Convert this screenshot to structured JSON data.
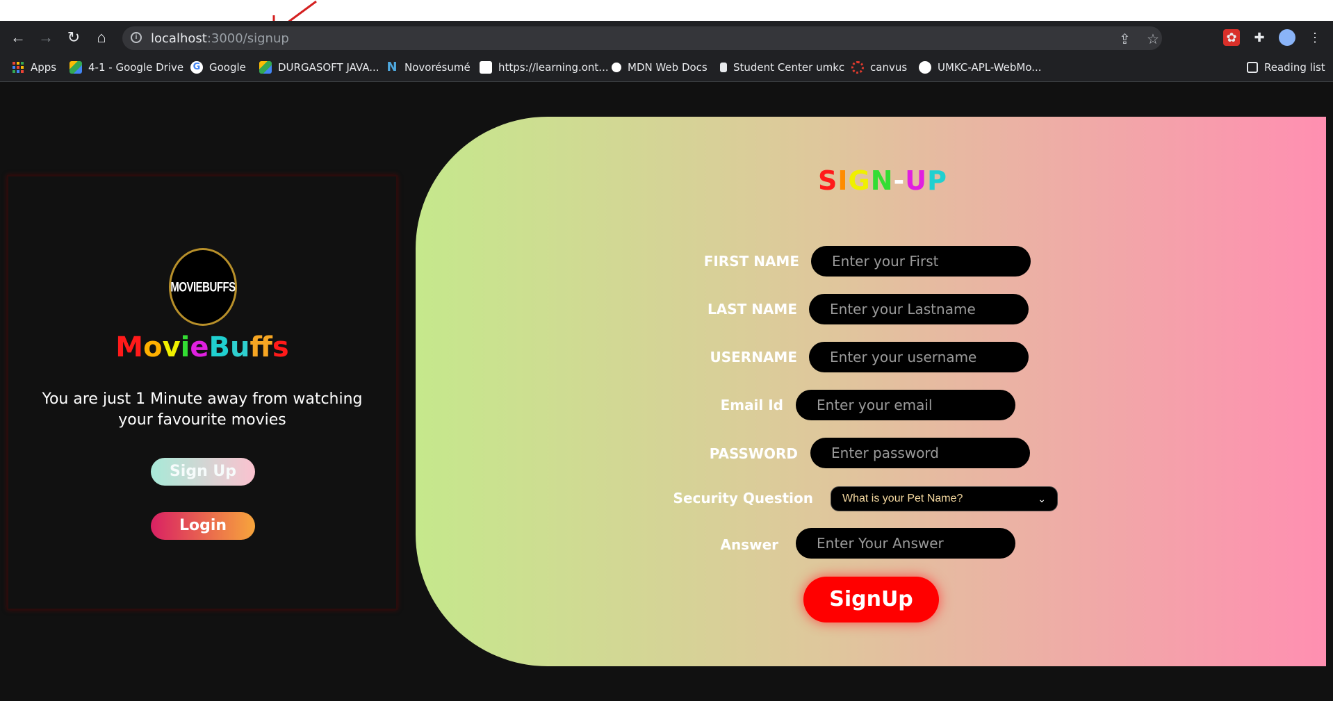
{
  "browser": {
    "url_host": "localhost",
    "url_rest": ":3000/signup",
    "bookmarks": [
      {
        "label": "Apps"
      },
      {
        "label": "4-1 - Google Drive"
      },
      {
        "label": "Google"
      },
      {
        "label": "DURGASOFT JAVA..."
      },
      {
        "label": "Novorésumé"
      },
      {
        "label": "https://learning.ont..."
      },
      {
        "label": "MDN Web Docs"
      },
      {
        "label": "Student Center umkc"
      },
      {
        "label": "canvus"
      },
      {
        "label": "UMKC-APL-WebMo..."
      }
    ],
    "reading_list": "Reading list"
  },
  "left": {
    "logo_text": "MOVIEBUFFS",
    "brand_letters": [
      {
        "ch": "M",
        "color": "#ff1a1a"
      },
      {
        "ch": "o",
        "color": "#ffb000"
      },
      {
        "ch": "v",
        "color": "#f0f000"
      },
      {
        "ch": "i",
        "color": "#33dd33"
      },
      {
        "ch": "e",
        "color": "#e020e0"
      },
      {
        "ch": "B",
        "color": "#20d0d0"
      },
      {
        "ch": "u",
        "color": "#2fcfcf"
      },
      {
        "ch": "f",
        "color": "#f6a623"
      },
      {
        "ch": "f",
        "color": "#a020f0"
      },
      {
        "ch": "s",
        "color": "#ff1a1a"
      }
    ],
    "tagline": "You are just 1 Minute away from watching your favourite movies",
    "signup_label": "Sign Up",
    "login_label": "Login"
  },
  "form": {
    "title_letters": [
      {
        "ch": "S",
        "color": "#ff1a1a"
      },
      {
        "ch": "I",
        "color": "#ff8c00"
      },
      {
        "ch": "G",
        "color": "#f0f000"
      },
      {
        "ch": "N",
        "color": "#33dd33"
      },
      {
        "ch": "-",
        "color": "#ffffff"
      },
      {
        "ch": "U",
        "color": "#e020e0"
      },
      {
        "ch": "P",
        "color": "#20d0d0"
      }
    ],
    "first_name_label": "FIRST NAME",
    "first_name_placeholder": "Enter your First",
    "last_name_label": "LAST NAME",
    "last_name_placeholder": "Enter your Lastname",
    "username_label": "USERNAME",
    "username_placeholder": "Enter your username",
    "email_label": "Email Id",
    "email_placeholder": "Enter your email",
    "password_label": "PASSWORD",
    "password_placeholder": "Enter password",
    "security_label": "Security Question",
    "security_selected": "What is your Pet Name?",
    "answer_label": "Answer",
    "answer_placeholder": "Enter Your Answer",
    "submit_label": "SignUp"
  }
}
